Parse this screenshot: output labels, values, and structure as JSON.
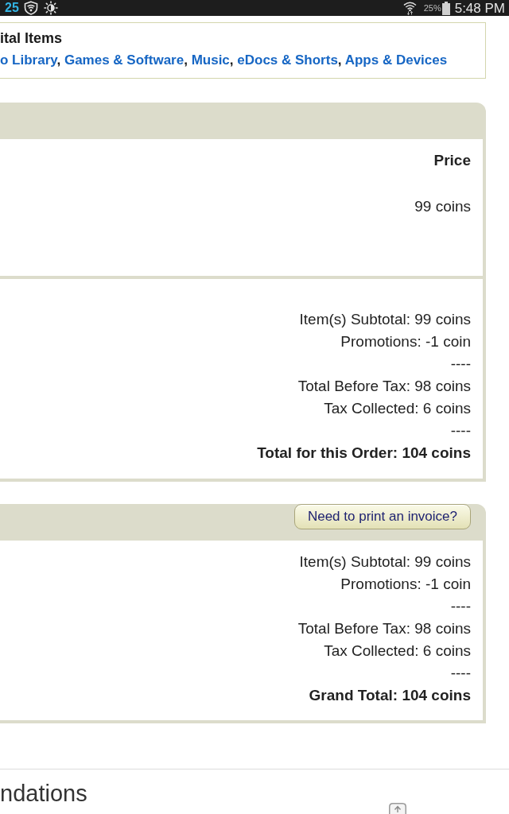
{
  "status_bar": {
    "notification_count": "25",
    "battery_percent": "25%",
    "time": "5:48 PM"
  },
  "digital_items": {
    "title": "ital Items",
    "links": [
      {
        "label": "o Library",
        "after": ","
      },
      {
        "label": "Games & Software",
        "after": ","
      },
      {
        "label": "Music",
        "after": ","
      },
      {
        "label": "eDocs & Shorts",
        "after": ","
      },
      {
        "label": "Apps & Devices"
      }
    ]
  },
  "order_panel": {
    "columns": [
      "Price"
    ],
    "rows": [
      [
        "99 coins"
      ]
    ],
    "summary": [
      {
        "kind": "amount",
        "text": "Item(s) Subtotal: 99 coins"
      },
      {
        "kind": "amount",
        "text": "Promotions: -1 coin"
      },
      {
        "kind": "rule",
        "text": "----"
      },
      {
        "kind": "amount",
        "text": "Total Before Tax: 98 coins"
      },
      {
        "kind": "amount",
        "text": "Tax Collected: 6 coins"
      },
      {
        "kind": "rule",
        "text": "----"
      },
      {
        "kind": "total",
        "text": "Total for this Order: 104 coins"
      }
    ]
  },
  "payment_panel": {
    "invoice_button": "Need to print an invoice?",
    "summary": [
      {
        "kind": "amount",
        "text": "Item(s) Subtotal: 99 coins"
      },
      {
        "kind": "amount",
        "text": "Promotions: -1 coin"
      },
      {
        "kind": "rule",
        "text": "----"
      },
      {
        "kind": "amount",
        "text": "Total Before Tax: 98 coins"
      },
      {
        "kind": "amount",
        "text": "Tax Collected: 6 coins"
      },
      {
        "kind": "rule",
        "text": "----"
      },
      {
        "kind": "total",
        "text": "Grand Total: 104 coins"
      }
    ]
  },
  "recommendations": {
    "title": "ndations"
  }
}
